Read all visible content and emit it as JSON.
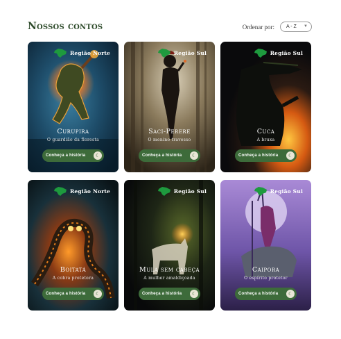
{
  "header": {
    "title": "Nossos contos",
    "sort_label": "Ordenar por:",
    "sort_value": "A - Z"
  },
  "cards": [
    {
      "region": "Região Norte",
      "name": "Curupira",
      "subtitle": "O guardião da floresta",
      "cta": "Conheça a história",
      "icon": "book-icon"
    },
    {
      "region": "Região Sul",
      "name": "Saci-Perere",
      "subtitle": "O menino travesso",
      "cta": "Conheça a história",
      "icon": "book-icon"
    },
    {
      "region": "Região Sul",
      "name": "Cuca",
      "subtitle": "A bruxa",
      "cta": "Conheça a história",
      "icon": "book-icon"
    },
    {
      "region": "Região Norte",
      "name": "Boitatá",
      "subtitle": "A cobra protetora",
      "cta": "Conheça a história",
      "icon": "book-icon"
    },
    {
      "region": "Região Sul",
      "name": "Mula sem cabeça",
      "subtitle": "A mulher amaldiçoada",
      "cta": "Conheça a história",
      "icon": "book-icon"
    },
    {
      "region": "Região Sul",
      "name": "Caipora",
      "subtitle": "O espírito protetor",
      "cta": "Conheça a história",
      "icon": "book-icon"
    }
  ],
  "colors": {
    "accent": "#3d6b3a",
    "title": "#2d4a2a",
    "map": "#1e9a3e"
  }
}
